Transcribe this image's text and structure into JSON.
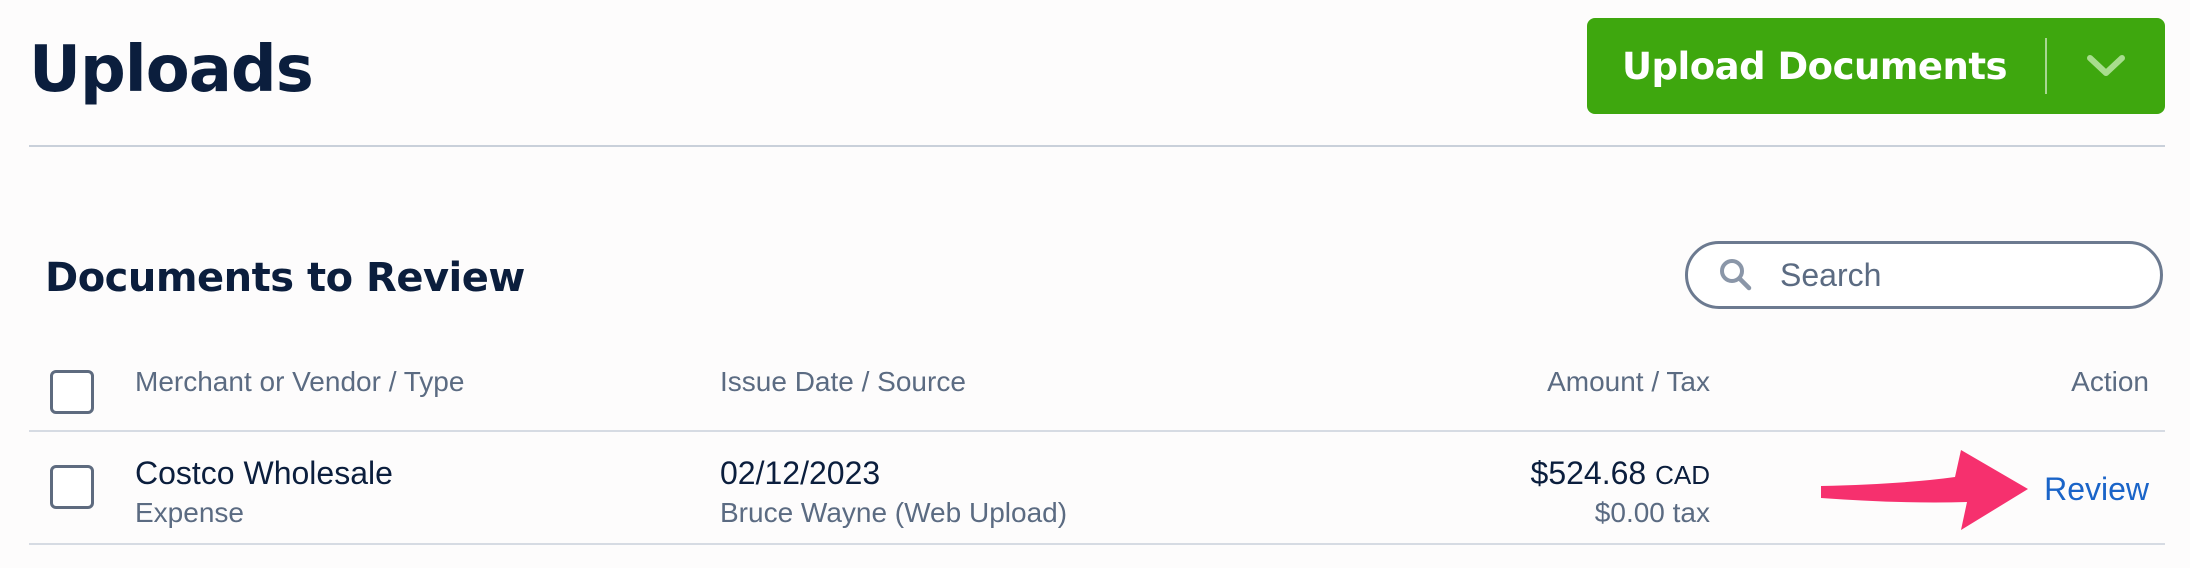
{
  "header": {
    "title": "Uploads",
    "upload_button_label": "Upload Documents",
    "accent_color": "#3ea70e"
  },
  "section": {
    "title": "Documents to Review"
  },
  "search": {
    "placeholder": "Search",
    "value": ""
  },
  "table": {
    "columns": [
      "Merchant or Vendor / Type",
      "Issue Date / Source",
      "Amount / Tax",
      "Action"
    ],
    "rows": [
      {
        "merchant": "Costco Wholesale",
        "type": "Expense",
        "issue_date": "02/12/2023",
        "source": "Bruce Wayne (Web Upload)",
        "amount": "$524.68",
        "currency": "CAD",
        "tax": "$0.00 tax",
        "action": "Review"
      }
    ]
  },
  "annotation": {
    "arrow_color": "#f6306e",
    "arrow_icon": "arrow-right-icon"
  },
  "icons": {
    "upload_caret": "chevron-down-icon",
    "search": "search-icon"
  }
}
